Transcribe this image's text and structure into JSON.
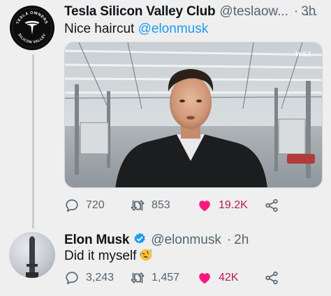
{
  "tweet1": {
    "display_name": "Tesla Silicon Valley Club",
    "handle": "@teslaow...",
    "separator": "·",
    "time": "3h",
    "text_prefix": "Nice haircut ",
    "mention": "@elonmusk",
    "media_watermark": "WSJ",
    "avatar_text_top": "TESLA OWNERS",
    "avatar_text_bottom": "SILICON VALLEY",
    "stats": {
      "replies": "720",
      "retweets": "853",
      "likes": "19.2K"
    },
    "more_label": "..."
  },
  "tweet2": {
    "display_name": "Elon Musk",
    "handle": "@elonmusk",
    "separator": "·",
    "time": "2h",
    "text": "Did it myself",
    "emoji": "rolling-on-the-floor-laughing",
    "verified": true,
    "stats": {
      "replies": "3,243",
      "retweets": "1,457",
      "likes": "42K"
    }
  },
  "colors": {
    "background": "#efefef",
    "text": "#0f1419",
    "secondary": "#536471",
    "link": "#1d9bf0",
    "like": "#f91880",
    "thread_line": "#c9ccd0"
  },
  "icons": [
    "reply-icon",
    "retweet-icon",
    "like-icon",
    "share-icon",
    "verified-badge-icon",
    "tesla-logo-icon"
  ]
}
